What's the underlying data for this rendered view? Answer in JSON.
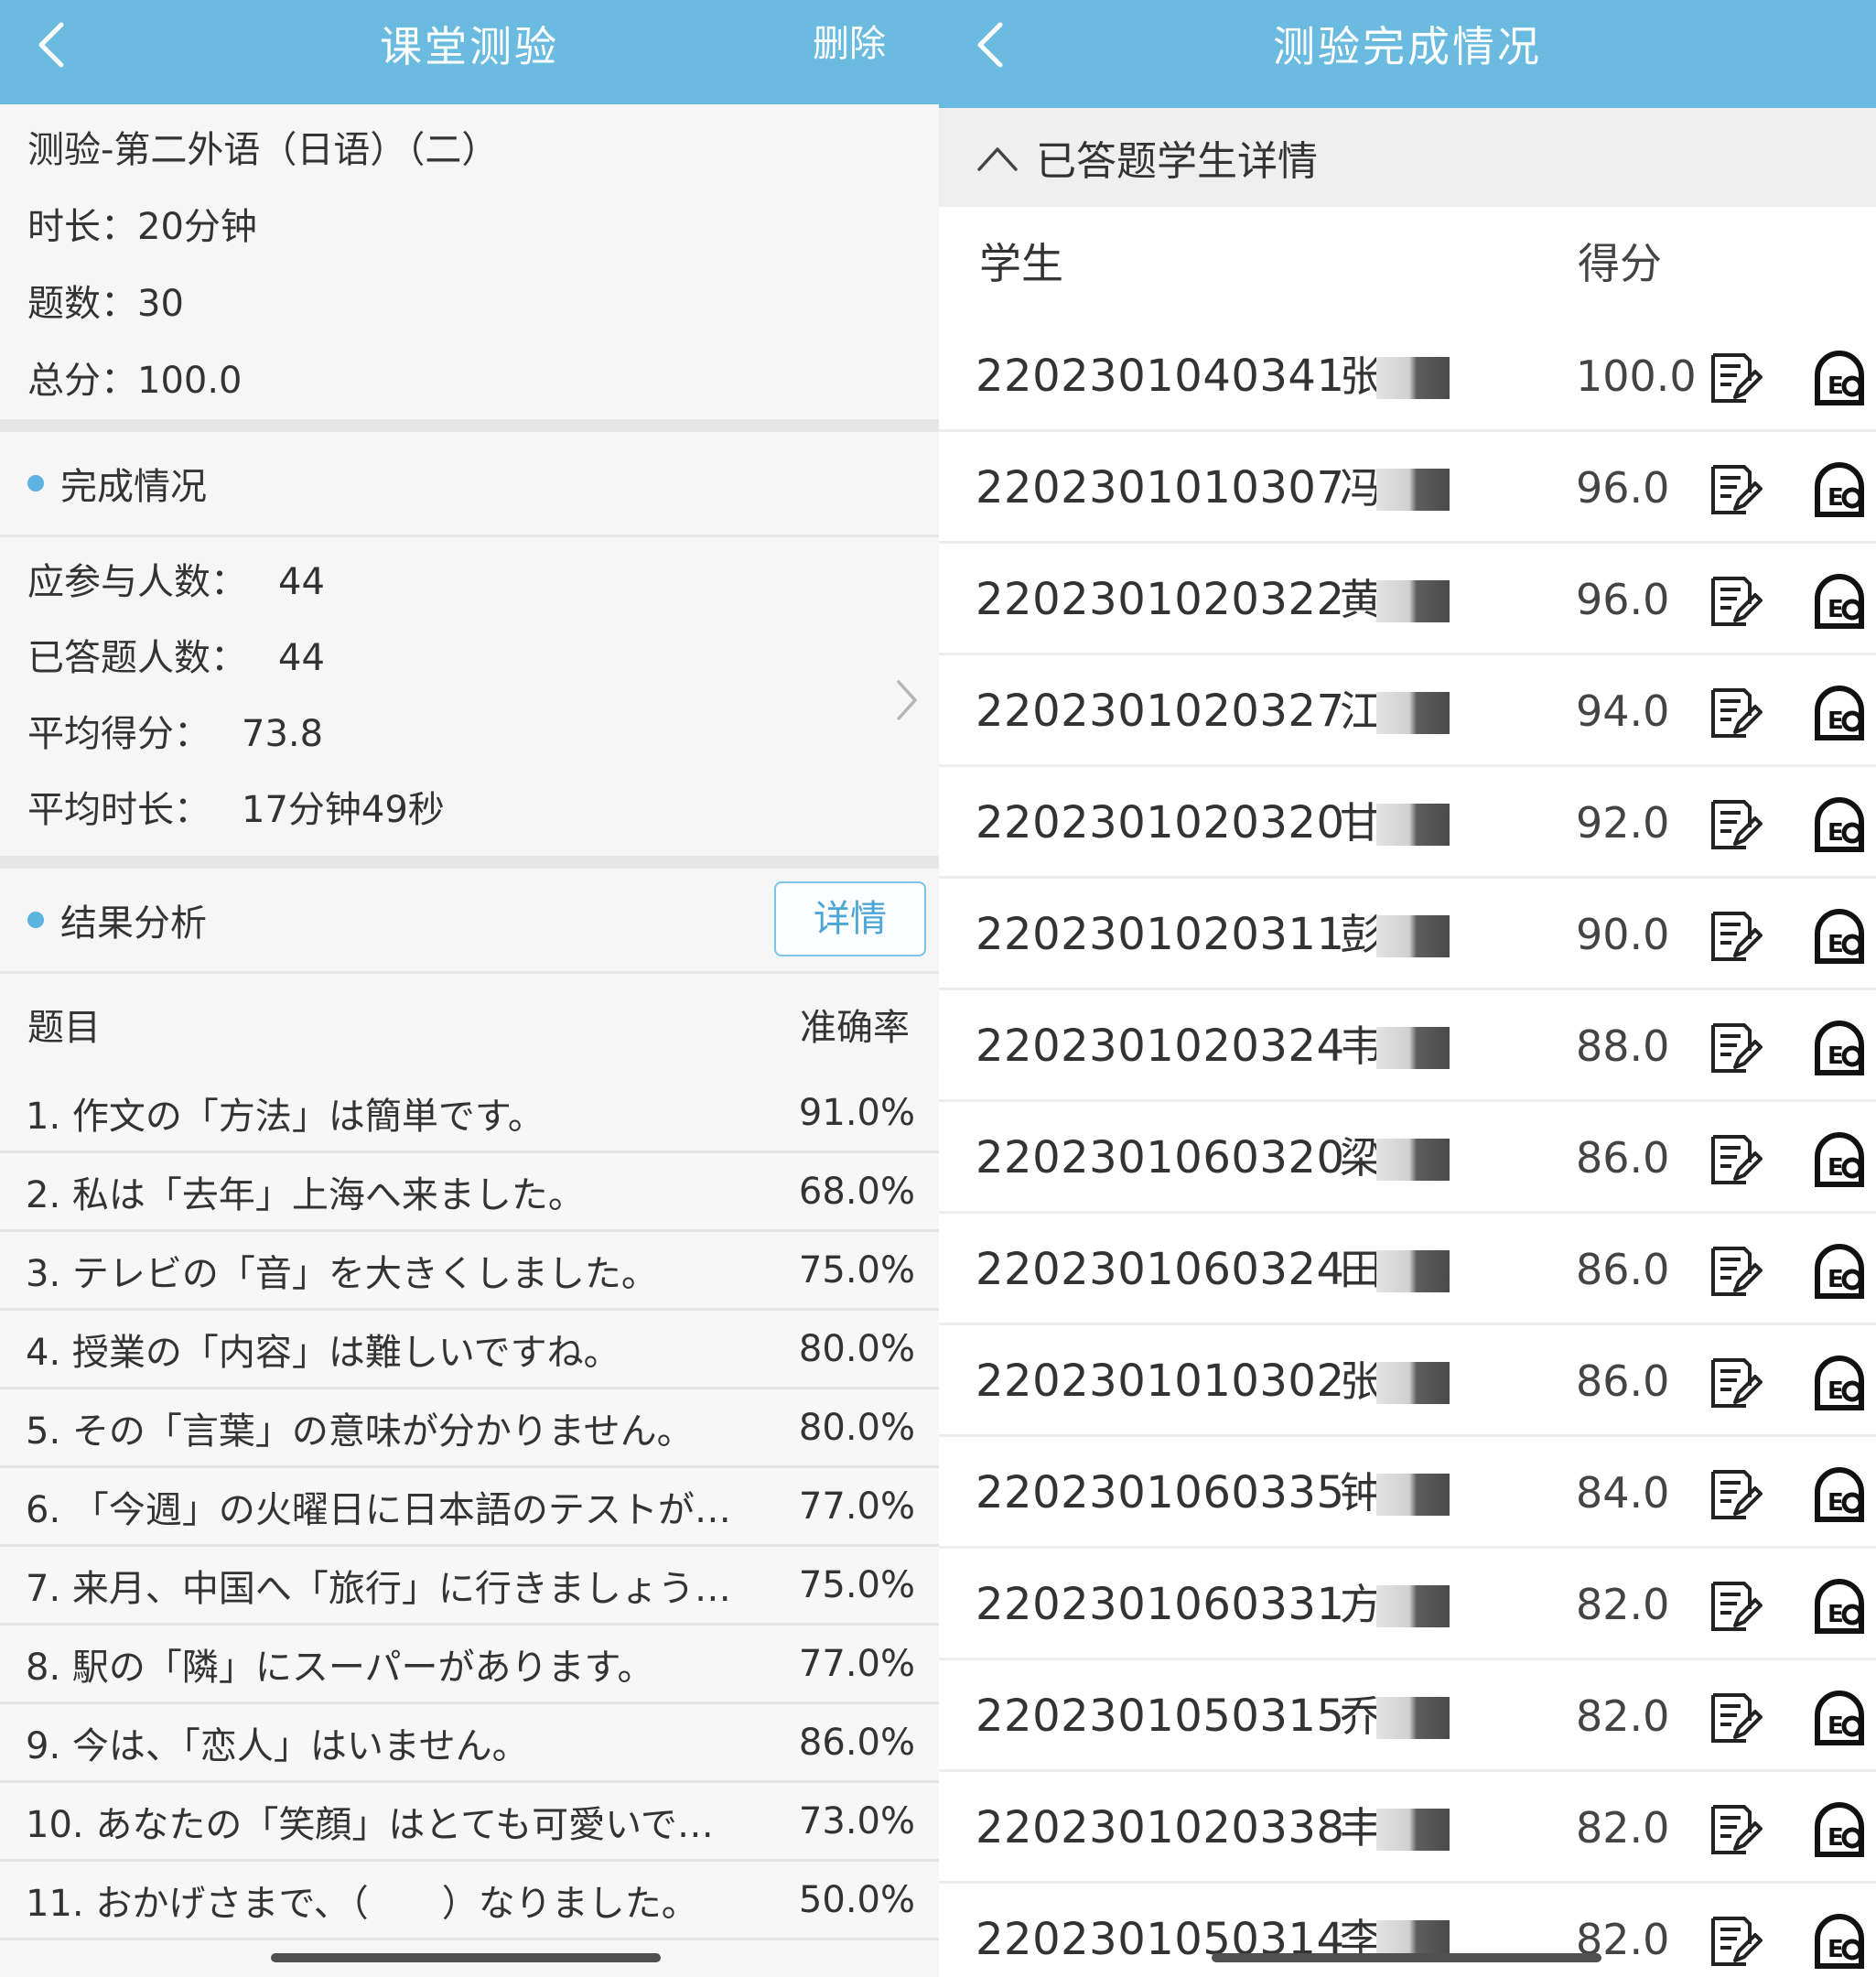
{
  "left": {
    "header": {
      "title": "课堂测验",
      "action": "删除"
    },
    "info": {
      "title": "测验-第二外语（日语）（二）",
      "duration": "时长：20分钟",
      "count": "题数：30",
      "total": "总分：100.0"
    },
    "completion": {
      "heading": "完成情况",
      "stats": [
        {
          "label": "应参与人数：",
          "value": "44"
        },
        {
          "label": "已答题人数：",
          "value": "44"
        },
        {
          "label": "平均得分：",
          "value": "73.8"
        },
        {
          "label": "平均时长：",
          "value": "17分钟49秒"
        }
      ]
    },
    "analysis": {
      "heading": "结果分析",
      "detail_button": "详情",
      "col_question": "题目",
      "col_rate": "准确率",
      "rows": [
        {
          "q": "1. 作文の「方法」は簡単です。",
          "rate": "91.0%"
        },
        {
          "q": "2. 私は「去年」上海へ来ました。",
          "rate": "68.0%"
        },
        {
          "q": "3. テレビの「音」を大きくしました。",
          "rate": "75.0%"
        },
        {
          "q": "4. 授業の「内容」は難しいですね。",
          "rate": "80.0%"
        },
        {
          "q": "5. その「言葉」の意味が分かりません。",
          "rate": "80.0%"
        },
        {
          "q": "6. 「今週」の火曜日に日本語のテストが…",
          "rate": "77.0%"
        },
        {
          "q": "7. 来月、中国へ「旅行」に行きましょう…",
          "rate": "75.0%"
        },
        {
          "q": "8. 駅の「隣」にスーパーがあります。",
          "rate": "77.0%"
        },
        {
          "q": "9. 今は、「恋人」はいません。",
          "rate": "86.0%"
        },
        {
          "q": "10. あなたの「笑顔」はとても可愛いで…",
          "rate": "73.0%"
        },
        {
          "q": "11. おかげさまで、（　　）なりました。",
          "rate": "50.0%"
        }
      ]
    }
  },
  "right": {
    "header": {
      "title": "测验完成情况"
    },
    "section": "已答题学生详情",
    "col_student": "学生",
    "col_score": "得分",
    "rows": [
      {
        "id": "2202301040341",
        "name": "张",
        "score": "100.0"
      },
      {
        "id": "2202301010307",
        "name": "冯",
        "score": "96.0"
      },
      {
        "id": "2202301020322",
        "name": "黄",
        "score": "96.0"
      },
      {
        "id": "2202301020327",
        "name": "江",
        "score": "94.0"
      },
      {
        "id": "2202301020320",
        "name": "甘",
        "score": "92.0"
      },
      {
        "id": "2202301020311",
        "name": "彭",
        "score": "90.0"
      },
      {
        "id": "2202301020324",
        "name": "韦",
        "score": "88.0"
      },
      {
        "id": "2202301060320",
        "name": "梁",
        "score": "86.0"
      },
      {
        "id": "2202301060324",
        "name": "田",
        "score": "86.0"
      },
      {
        "id": "2202301010302",
        "name": "张",
        "score": "86.0"
      },
      {
        "id": "2202301060335",
        "name": "钟",
        "score": "84.0"
      },
      {
        "id": "2202301060331",
        "name": "方",
        "score": "82.0"
      },
      {
        "id": "2202301050315",
        "name": "乔",
        "score": "82.0"
      },
      {
        "id": "2202301020338",
        "name": "丰",
        "score": "82.0"
      },
      {
        "id": "2202301050314",
        "name": "李",
        "score": "82.0"
      }
    ]
  },
  "colors": {
    "header_bg": "#6bbbe0",
    "accent_dot": "#5cb3e0"
  },
  "icons": [
    "back-chevron-icon",
    "chevron-right-icon",
    "chevron-up-icon",
    "edit-document-icon",
    "eo-view-icon"
  ]
}
